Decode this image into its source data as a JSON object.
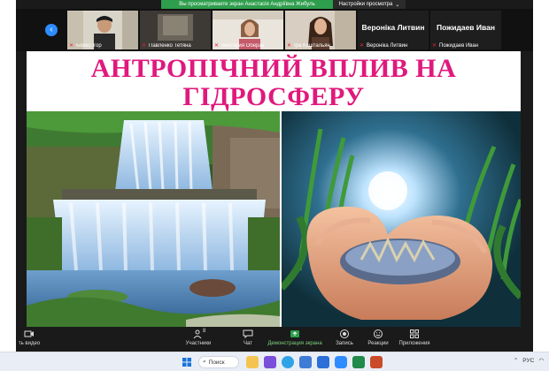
{
  "banner": {
    "message": "Вы просматриваете экран Анастасія Андріївна Жибуль",
    "options_label": "Настройки просмотра"
  },
  "gallery": {
    "participants": [
      {
        "name": "Бойко Ігор",
        "muted": true
      },
      {
        "name": "Павленко Тетяна",
        "muted": true
      },
      {
        "name": "Виктория Обераз",
        "muted": true
      },
      {
        "name": "Іра Каштальян",
        "muted": true
      },
      {
        "name": "Вероніка Литвин",
        "display": "Вероніка Литвин",
        "muted": true
      },
      {
        "name": "Пожидаев Иван",
        "display": "Пожидаев Иван",
        "muted": true
      }
    ]
  },
  "slide": {
    "title_line1": "АНТРОПІЧНИЙ ВПЛИВ НА",
    "title_line2": "ГІДРОСФЕРУ"
  },
  "toolbar": {
    "video_label": "ть видео",
    "participants_label": "Участники",
    "participants_count": "8",
    "chat_label": "Чат",
    "share_label": "Демонстрация экрана",
    "record_label": "Запись",
    "reactions_label": "Реакции",
    "apps_label": "Приложения"
  },
  "taskbar": {
    "search_label": "Поиск",
    "language": "РУС"
  },
  "colors": {
    "title": "#e0197d",
    "banner_green": "#2e9e4c",
    "accent_blue": "#2d8cff",
    "muted_red": "#e23333"
  }
}
